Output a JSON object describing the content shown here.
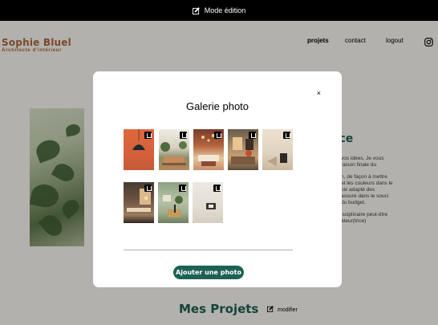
{
  "edit_bar": {
    "label": "Mode édition",
    "icon": "edit-icon"
  },
  "logo": {
    "name": "Sophie Bluel",
    "subtitle": "Architecte d'intérieur"
  },
  "nav": {
    "projets": "projets",
    "contact": "contact",
    "logout": "logout",
    "instagram_icon": "instagram-icon"
  },
  "intro": {
    "title_fragment": "ace",
    "paragraphs": [
      "vos idées. Je vous\nraison finale du",
      "n, de façon à mettre\net les couleurs dans le\noix adapté des\nassuré dans le souci\ndu budget.",
      "isciplinaire peut-être\nateur(trice)"
    ]
  },
  "projects": {
    "title": "Mes Projets",
    "edit_label": "modifier"
  },
  "modal": {
    "close": "×",
    "title": "Galerie photo",
    "add_button": "Ajouter une photo",
    "photos": [
      {
        "name": "photo-1"
      },
      {
        "name": "photo-2"
      },
      {
        "name": "photo-3"
      },
      {
        "name": "photo-4"
      },
      {
        "name": "photo-5"
      },
      {
        "name": "photo-6"
      },
      {
        "name": "photo-7"
      },
      {
        "name": "photo-8"
      }
    ]
  },
  "colors": {
    "brand": "#b1663c",
    "accent": "#1d6154"
  }
}
